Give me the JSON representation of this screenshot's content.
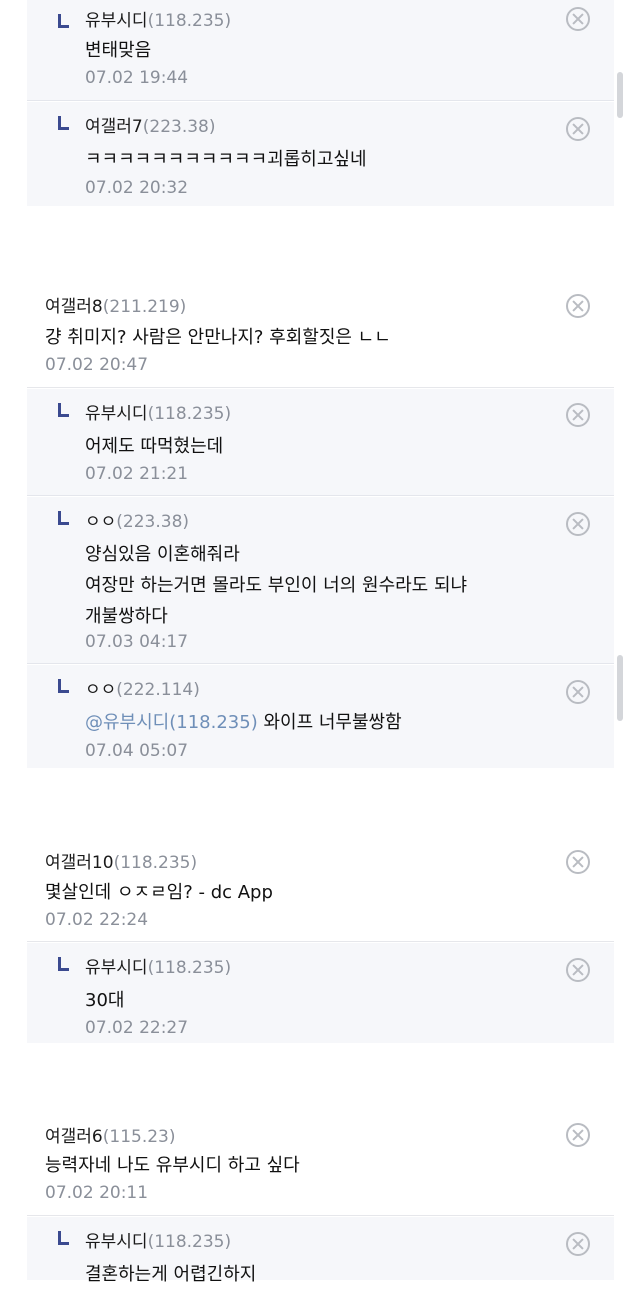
{
  "threads": [
    {
      "replies": [
        {
          "author": "유부시디",
          "ip": "(118.235)",
          "lines": [
            "변태맞음"
          ],
          "time": "07.02 19:44"
        },
        {
          "author": "여갤러7",
          "ip": "(223.38)",
          "lines": [
            "ㅋㅋㅋㅋㅋㅋㅋㅋㅋㅋㅋ괴롭히고싶네"
          ],
          "time": "07.02 20:32"
        }
      ]
    },
    {
      "comment": {
        "author": "여갤러8",
        "ip": "(211.219)",
        "lines": [
          "걍 취미지? 사람은 안만나지? 후회할짓은 ㄴㄴ"
        ],
        "time": "07.02 20:47"
      },
      "replies": [
        {
          "author": "유부시디",
          "ip": "(118.235)",
          "lines": [
            "어제도 따먹혔는데"
          ],
          "time": "07.02 21:21"
        },
        {
          "author": "ㅇㅇ",
          "ip": "(223.38)",
          "lines": [
            "양심있음 이혼해줘라",
            "여장만 하는거면 몰라도 부인이 너의 원수라도 되냐",
            "개불쌍하다"
          ],
          "time": "07.03 04:17"
        },
        {
          "author": "ㅇㅇ",
          "ip": "(222.114)",
          "mention": "@유부시디(118.235)",
          "lines": [
            " 와이프 너무불쌍함"
          ],
          "time": "07.04 05:07"
        }
      ]
    },
    {
      "comment": {
        "author": "여갤러10",
        "ip": "(118.235)",
        "lines": [
          "몇살인데 ㅇㅈㄹ임? - dc App"
        ],
        "time": "07.02 22:24"
      },
      "replies": [
        {
          "author": "유부시디",
          "ip": "(118.235)",
          "lines": [
            "30대"
          ],
          "time": "07.02 22:27"
        }
      ]
    },
    {
      "comment": {
        "author": "여갤러6",
        "ip": "(115.23)",
        "lines": [
          "능력자네 나도 유부시디 하고 싶다"
        ],
        "time": "07.02 20:11"
      },
      "replies": [
        {
          "author": "유부시디",
          "ip": "(118.235)",
          "lines": [
            "결혼하는게 어렵긴하지"
          ],
          "time": ""
        }
      ]
    }
  ],
  "icons": {
    "reply_arrow": "reply-arrow-icon",
    "delete": "delete-circle-x-icon"
  },
  "colors": {
    "reply_bg": "#f6f7fa",
    "ip": "#8a8f99",
    "mention": "#6f8fb8",
    "reply_arrow": "#3b4a8f"
  }
}
